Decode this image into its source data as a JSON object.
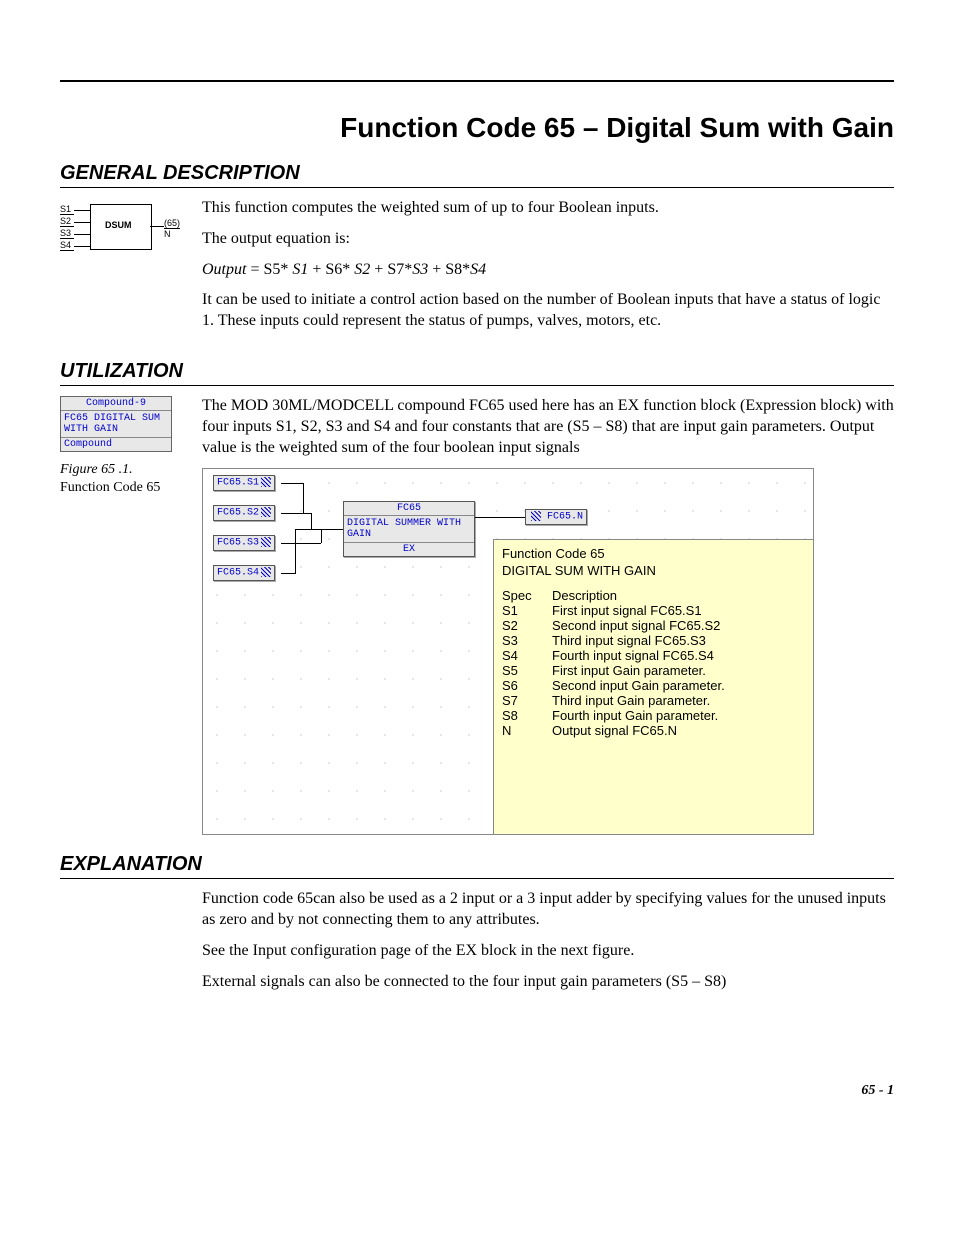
{
  "title": "Function Code 65 – Digital Sum with Gain",
  "sections": {
    "general": {
      "heading": "GENERAL DESCRIPTION",
      "p1": "This function computes the weighted sum of up to four Boolean inputs.",
      "p2": "The output equation is:",
      "eq_lhs": "Output",
      "eq_rhs1": "  = S5* ",
      "eq_s1": "S1",
      "eq_rhs2": " + S6* ",
      "eq_s2": "S2",
      "eq_rhs3": "  + S7*",
      "eq_s3": "S3",
      "eq_rhs4": "  +  S8*",
      "eq_s4": "S4",
      "p3": "It can be used to initiate a control action based on the number of Boolean inputs that have a status of logic 1. These inputs could represent the status of pumps, valves, motors, etc."
    },
    "utilization": {
      "heading": "UTILIZATION",
      "p1": "The MOD 30ML/MODCELL compound FC65 used here has an EX function block (Expression block) with four inputs S1, S2, S3 and S4 and four constants that are (S5 – S8) that are input gain parameters. Output value is the weighted sum of the four boolean input signals",
      "fig_label": "Figure 65 .1.",
      "fig_sub": "Function Code 65"
    },
    "explanation": {
      "heading": "EXPLANATION",
      "p1": "Function code 65can also be used as a 2 input or a 3 input adder by specifying values for the unused inputs as zero and by not connecting them to any attributes.",
      "p2": "See the Input configuration page of the EX block in the next figure.",
      "p3": "External signals can also be connected to the four input gain parameters (S5 – S8)"
    }
  },
  "dsum_icon": {
    "inputs": [
      "S1",
      "S2",
      "S3",
      "S4"
    ],
    "label": "DSUM",
    "out_top": "(65)",
    "out_bot": "N"
  },
  "compound_box": {
    "head": "Compound-9",
    "body": "FC65  DIGITAL SUM WITH GAIN",
    "foot": "Compound"
  },
  "diagram": {
    "inputs": [
      "FC65.S1",
      "FC65.S2",
      "FC65.S3",
      "FC65.S4"
    ],
    "main_head": "FC65",
    "main_body": "DIGITAL SUMMER WITH GAIN",
    "main_foot": "EX",
    "output": "FC65.N",
    "panel": {
      "title": "Function Code 65",
      "subtitle": "DIGITAL SUM WITH GAIN",
      "spec_h": "Spec",
      "desc_h": "Description",
      "rows": [
        {
          "spec": "S1",
          "desc": "First input signal FC65.S1"
        },
        {
          "spec": "S2",
          "desc": "Second input signal FC65.S2"
        },
        {
          "spec": "S3",
          "desc": "Third input signal FC65.S3"
        },
        {
          "spec": "S4",
          "desc": "Fourth input signal FC65.S4"
        },
        {
          "spec": "S5",
          "desc": "First input Gain parameter."
        },
        {
          "spec": "S6",
          "desc": "Second input Gain parameter."
        },
        {
          "spec": "S7",
          "desc": "Third input Gain parameter."
        },
        {
          "spec": "S8",
          "desc": "Fourth input Gain parameter."
        },
        {
          "spec": "N",
          "desc": "Output signal FC65.N"
        }
      ]
    }
  },
  "page_num": "65 - 1"
}
